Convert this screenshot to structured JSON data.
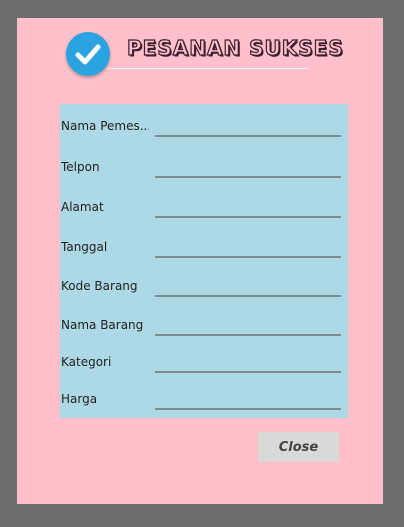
{
  "dialog": {
    "title": "PESANAN SUKSES",
    "icon": "check-circle-icon",
    "close_label": "Close"
  },
  "form": {
    "fields": [
      {
        "label": "Nama Pemes...",
        "value": ""
      },
      {
        "label": "Telpon",
        "value": ""
      },
      {
        "label": "Alamat",
        "value": ""
      },
      {
        "label": "Tanggal",
        "value": ""
      },
      {
        "label": "Kode Barang",
        "value": ""
      },
      {
        "label": "Nama Barang",
        "value": ""
      },
      {
        "label": "Kategori",
        "value": ""
      },
      {
        "label": "Harga",
        "value": ""
      }
    ]
  },
  "colors": {
    "dialog_bg": "#ffc0cb",
    "panel_bg": "#add8e6",
    "icon_bg": "#2aa3e0",
    "outer_bg": "#6e6e6e"
  }
}
